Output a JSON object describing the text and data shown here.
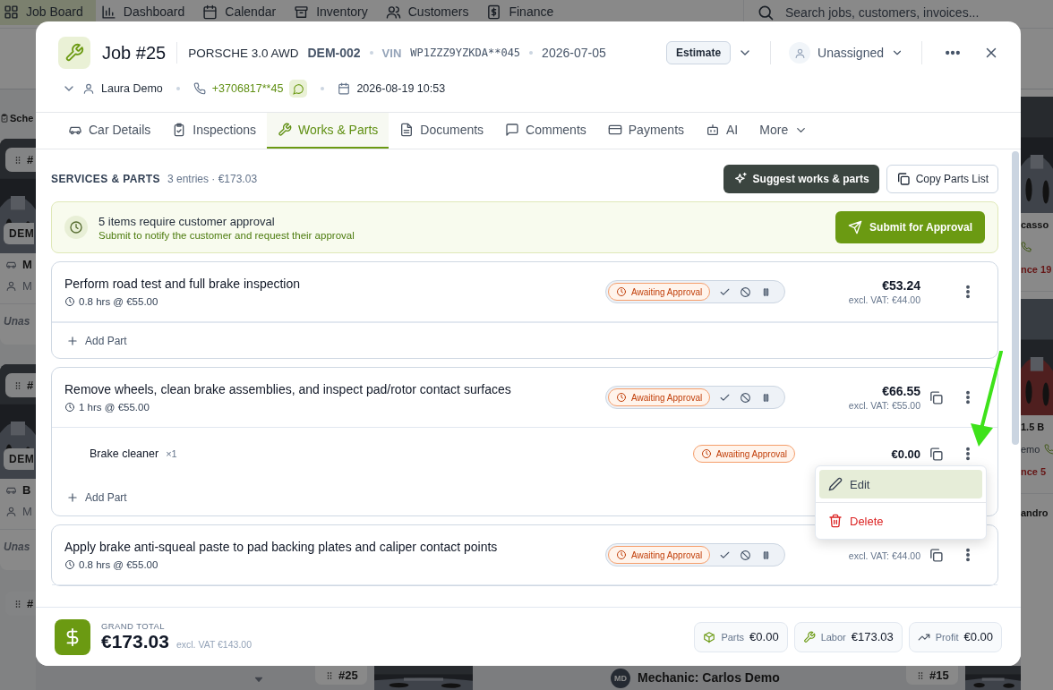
{
  "background": {
    "nav": [
      {
        "label": "Job Board",
        "selected": true
      },
      {
        "label": "Dashboard",
        "selected": false
      },
      {
        "label": "Calendar",
        "selected": false
      },
      {
        "label": "Inventory",
        "selected": false
      },
      {
        "label": "Customers",
        "selected": false
      },
      {
        "label": "Finance",
        "selected": false
      }
    ],
    "search": {
      "placeholder": "Search jobs, customers, invoices..."
    },
    "left_section": "Sche",
    "left_cards": [
      {
        "tag": "#",
        "plate": "DEM",
        "car": "M",
        "person": "M",
        "assignee": "Unas"
      },
      {
        "tag": "#",
        "plate": "DEM",
        "car": "B",
        "person": "M",
        "assignee": "Unas"
      }
    ],
    "left_last_tag": "#",
    "right_cards": [
      {
        "car": "casso",
        "due": "nce 19"
      },
      {
        "car": "1.5 B",
        "person": "emo",
        "due": "nce 5"
      }
    ],
    "right_last": "andro",
    "bottom": [
      {
        "kind": "tag",
        "label": "#25"
      },
      {
        "kind": "mechanic",
        "initials": "MD",
        "label": "Mechanic: Carlos Demo"
      },
      {
        "kind": "tag",
        "label": "#15"
      }
    ]
  },
  "job": {
    "title": "Job #25",
    "car": "PORSCHE 3.0 AWD",
    "plate": "DEM-002",
    "vin_label": "VIN",
    "vin": "WP1ZZZ9YZKDA**045",
    "date": "2026-07-05",
    "type_button": "Estimate",
    "assignee": "Unassigned",
    "customer": "Laura Demo",
    "phone": "+3706817**45",
    "appointment": "2026-08-19 10:53"
  },
  "tabs": [
    {
      "label": "Car Details",
      "selected": false
    },
    {
      "label": "Inspections",
      "selected": false
    },
    {
      "label": "Works & Parts",
      "selected": true
    },
    {
      "label": "Documents",
      "selected": false
    },
    {
      "label": "Comments",
      "selected": false
    },
    {
      "label": "Payments",
      "selected": false
    },
    {
      "label": "AI",
      "selected": false
    },
    {
      "label": "More",
      "selected": false
    }
  ],
  "section": {
    "title": "SERVICES & PARTS",
    "summary": "3 entries · €173.03",
    "suggest_button": "Suggest works & parts",
    "copy_button": "Copy Parts List"
  },
  "approval": {
    "title": "5 items require customer approval",
    "text": "Submit to notify the customer and request their approval",
    "button": "Submit for Approval"
  },
  "services": [
    {
      "name": "Perform road test and full brake inspection",
      "time": "0.8 hrs @ €55.00",
      "status": {
        "label": "Awaiting Approval",
        "kind": "awaiting"
      },
      "price": "€53.24",
      "excl": "excl. VAT: €44.00",
      "copy": false,
      "add_part": "Add Part"
    },
    {
      "name": "Remove wheels, clean brake assemblies, and inspect pad/rotor contact surfaces",
      "time": "1 hrs @ €55.00",
      "status": {
        "label": "Awaiting Approval",
        "kind": "awaiting"
      },
      "price": "€66.55",
      "excl": "excl. VAT: €55.00",
      "copy": true,
      "parts": [
        {
          "name": "Brake cleaner",
          "qty": "×1",
          "status": {
            "label": "Awaiting Approval",
            "kind": "awaiting"
          },
          "price": "€0.00",
          "menu": {
            "items": [
              {
                "label": "Edit",
                "kind": "edit",
                "selected": true
              },
              {
                "label": "Delete",
                "kind": "delete",
                "selected": false
              }
            ]
          }
        }
      ],
      "add_part": "Add Part"
    },
    {
      "name": "Apply brake anti-squeal paste to pad backing plates and caliper contact points",
      "time": "0.8 hrs @ €55.00",
      "status": {
        "label": "Awaiting Approval",
        "kind": "awaiting"
      },
      "excl": "excl. VAT: €44.00",
      "copy": true
    }
  ],
  "footer": {
    "label": "GRAND TOTAL",
    "total": "€173.03",
    "excl": "excl. VAT €143.00",
    "chips": [
      {
        "label": "Parts",
        "value": "€0.00"
      },
      {
        "label": "Labor",
        "value": "€173.03"
      },
      {
        "label": "Profit",
        "value": "€0.00"
      }
    ]
  }
}
